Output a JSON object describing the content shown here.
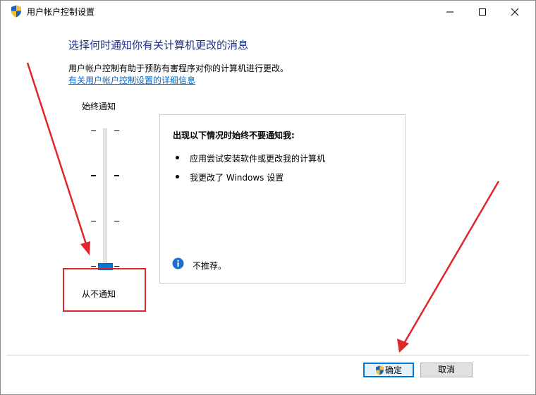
{
  "window": {
    "title": "用户帐户控制设置",
    "title_icon": "uac-shield-icon",
    "caption_icons": [
      "minimize-icon",
      "maximize-icon",
      "close-icon"
    ]
  },
  "main": {
    "heading": "选择何时通知你有关计算机更改的消息",
    "description": "用户帐户控制有助于预防有害程序对你的计算机进行更改。",
    "help_link": "有关用户帐户控制设置的详细信息"
  },
  "slider": {
    "top_label": "始终通知",
    "bottom_label": "从不通知",
    "levels": 4,
    "selected_level": 1
  },
  "info": {
    "title": "出现以下情况时始终不要通知我:",
    "bullets": [
      "应用尝试安装软件或更改我的计算机",
      "我更改了 Windows 设置"
    ],
    "recommendation": "不推荐。",
    "recommendation_icon": "info-icon"
  },
  "buttons": {
    "ok": "确定",
    "cancel": "取消"
  },
  "annotation": {
    "color": "#e0262a"
  },
  "colors": {
    "heading": "#1e3287",
    "link": "#0066cc",
    "accent": "#0078d7"
  }
}
